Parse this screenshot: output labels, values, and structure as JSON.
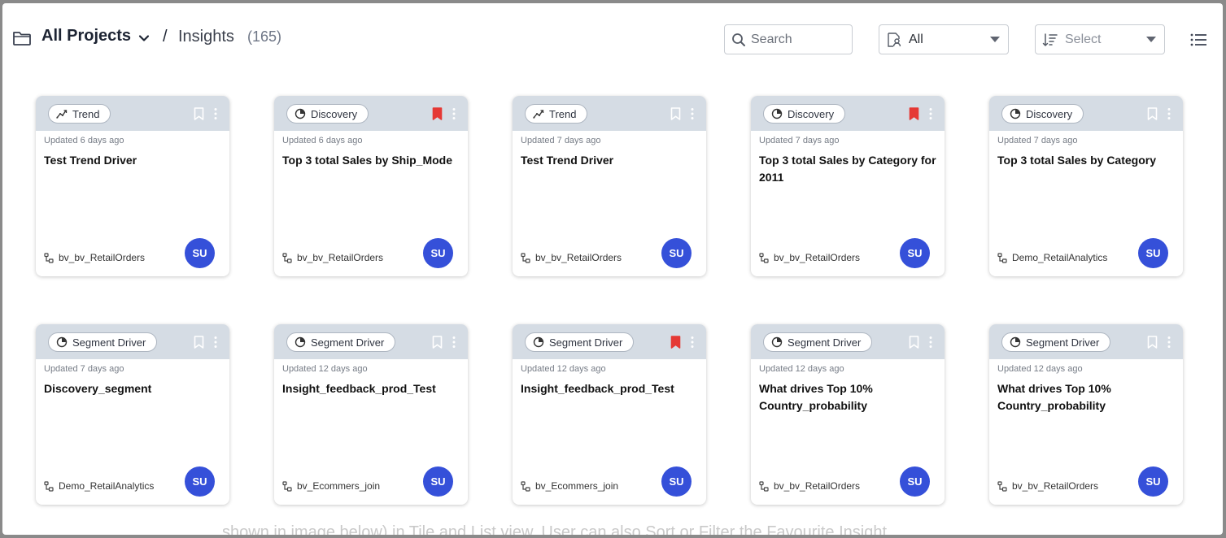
{
  "header": {
    "title": "All Projects",
    "separator": "/",
    "crumb": "Insights",
    "count": "(165)"
  },
  "toolbar": {
    "search_placeholder": "Search",
    "filter_value": "All",
    "sort_placeholder": "Select"
  },
  "colors": {
    "accent": "#3550d9",
    "bookmark_active": "#e53935",
    "card_header": "#d5dce4"
  },
  "cards": [
    {
      "type": "Trend",
      "type_icon": "trend-icon",
      "bookmarked": false,
      "updated": "Updated 6 days ago",
      "title": "Test Trend Driver",
      "dataset": "bv_bv_RetailOrders",
      "owner": "SU"
    },
    {
      "type": "Discovery",
      "type_icon": "discovery-icon",
      "bookmarked": true,
      "updated": "Updated 6 days ago",
      "title": "Top 3 total Sales by Ship_Mode",
      "dataset": "bv_bv_RetailOrders",
      "owner": "SU"
    },
    {
      "type": "Trend",
      "type_icon": "trend-icon",
      "bookmarked": false,
      "updated": "Updated 7 days ago",
      "title": "Test Trend Driver",
      "dataset": "bv_bv_RetailOrders",
      "owner": "SU"
    },
    {
      "type": "Discovery",
      "type_icon": "discovery-icon",
      "bookmarked": true,
      "updated": "Updated 7 days ago",
      "title": "Top 3 total Sales by Category for 2011",
      "dataset": "bv_bv_RetailOrders",
      "owner": "SU"
    },
    {
      "type": "Discovery",
      "type_icon": "discovery-icon",
      "bookmarked": false,
      "updated": "Updated 7 days ago",
      "title": "Top 3 total Sales by Category",
      "dataset": "Demo_RetailAnalytics",
      "owner": "SU"
    },
    {
      "type": "Segment Driver",
      "type_icon": "segment-icon",
      "bookmarked": false,
      "updated": "Updated 7 days ago",
      "title": "Discovery_segment",
      "dataset": "Demo_RetailAnalytics",
      "owner": "SU"
    },
    {
      "type": "Segment Driver",
      "type_icon": "segment-icon",
      "bookmarked": false,
      "updated": "Updated 12 days ago",
      "title": "Insight_feedback_prod_Test",
      "dataset": "bv_Ecommers_join",
      "owner": "SU"
    },
    {
      "type": "Segment Driver",
      "type_icon": "segment-icon",
      "bookmarked": true,
      "updated": "Updated 12 days ago",
      "title": "Insight_feedback_prod_Test",
      "dataset": "bv_Ecommers_join",
      "owner": "SU"
    },
    {
      "type": "Segment Driver",
      "type_icon": "segment-icon",
      "bookmarked": false,
      "updated": "Updated 12 days ago",
      "title": "What drives Top 10% Country_probability",
      "dataset": "bv_bv_RetailOrders",
      "owner": "SU"
    },
    {
      "type": "Segment Driver",
      "type_icon": "segment-icon",
      "bookmarked": false,
      "updated": "Updated 12 days ago",
      "title": "What drives Top 10% Country_probability",
      "dataset": "bv_bv_RetailOrders",
      "owner": "SU"
    }
  ],
  "background_text": "shown in image below) in Tile and List view. User can also Sort or Filter the Favourite Insight."
}
